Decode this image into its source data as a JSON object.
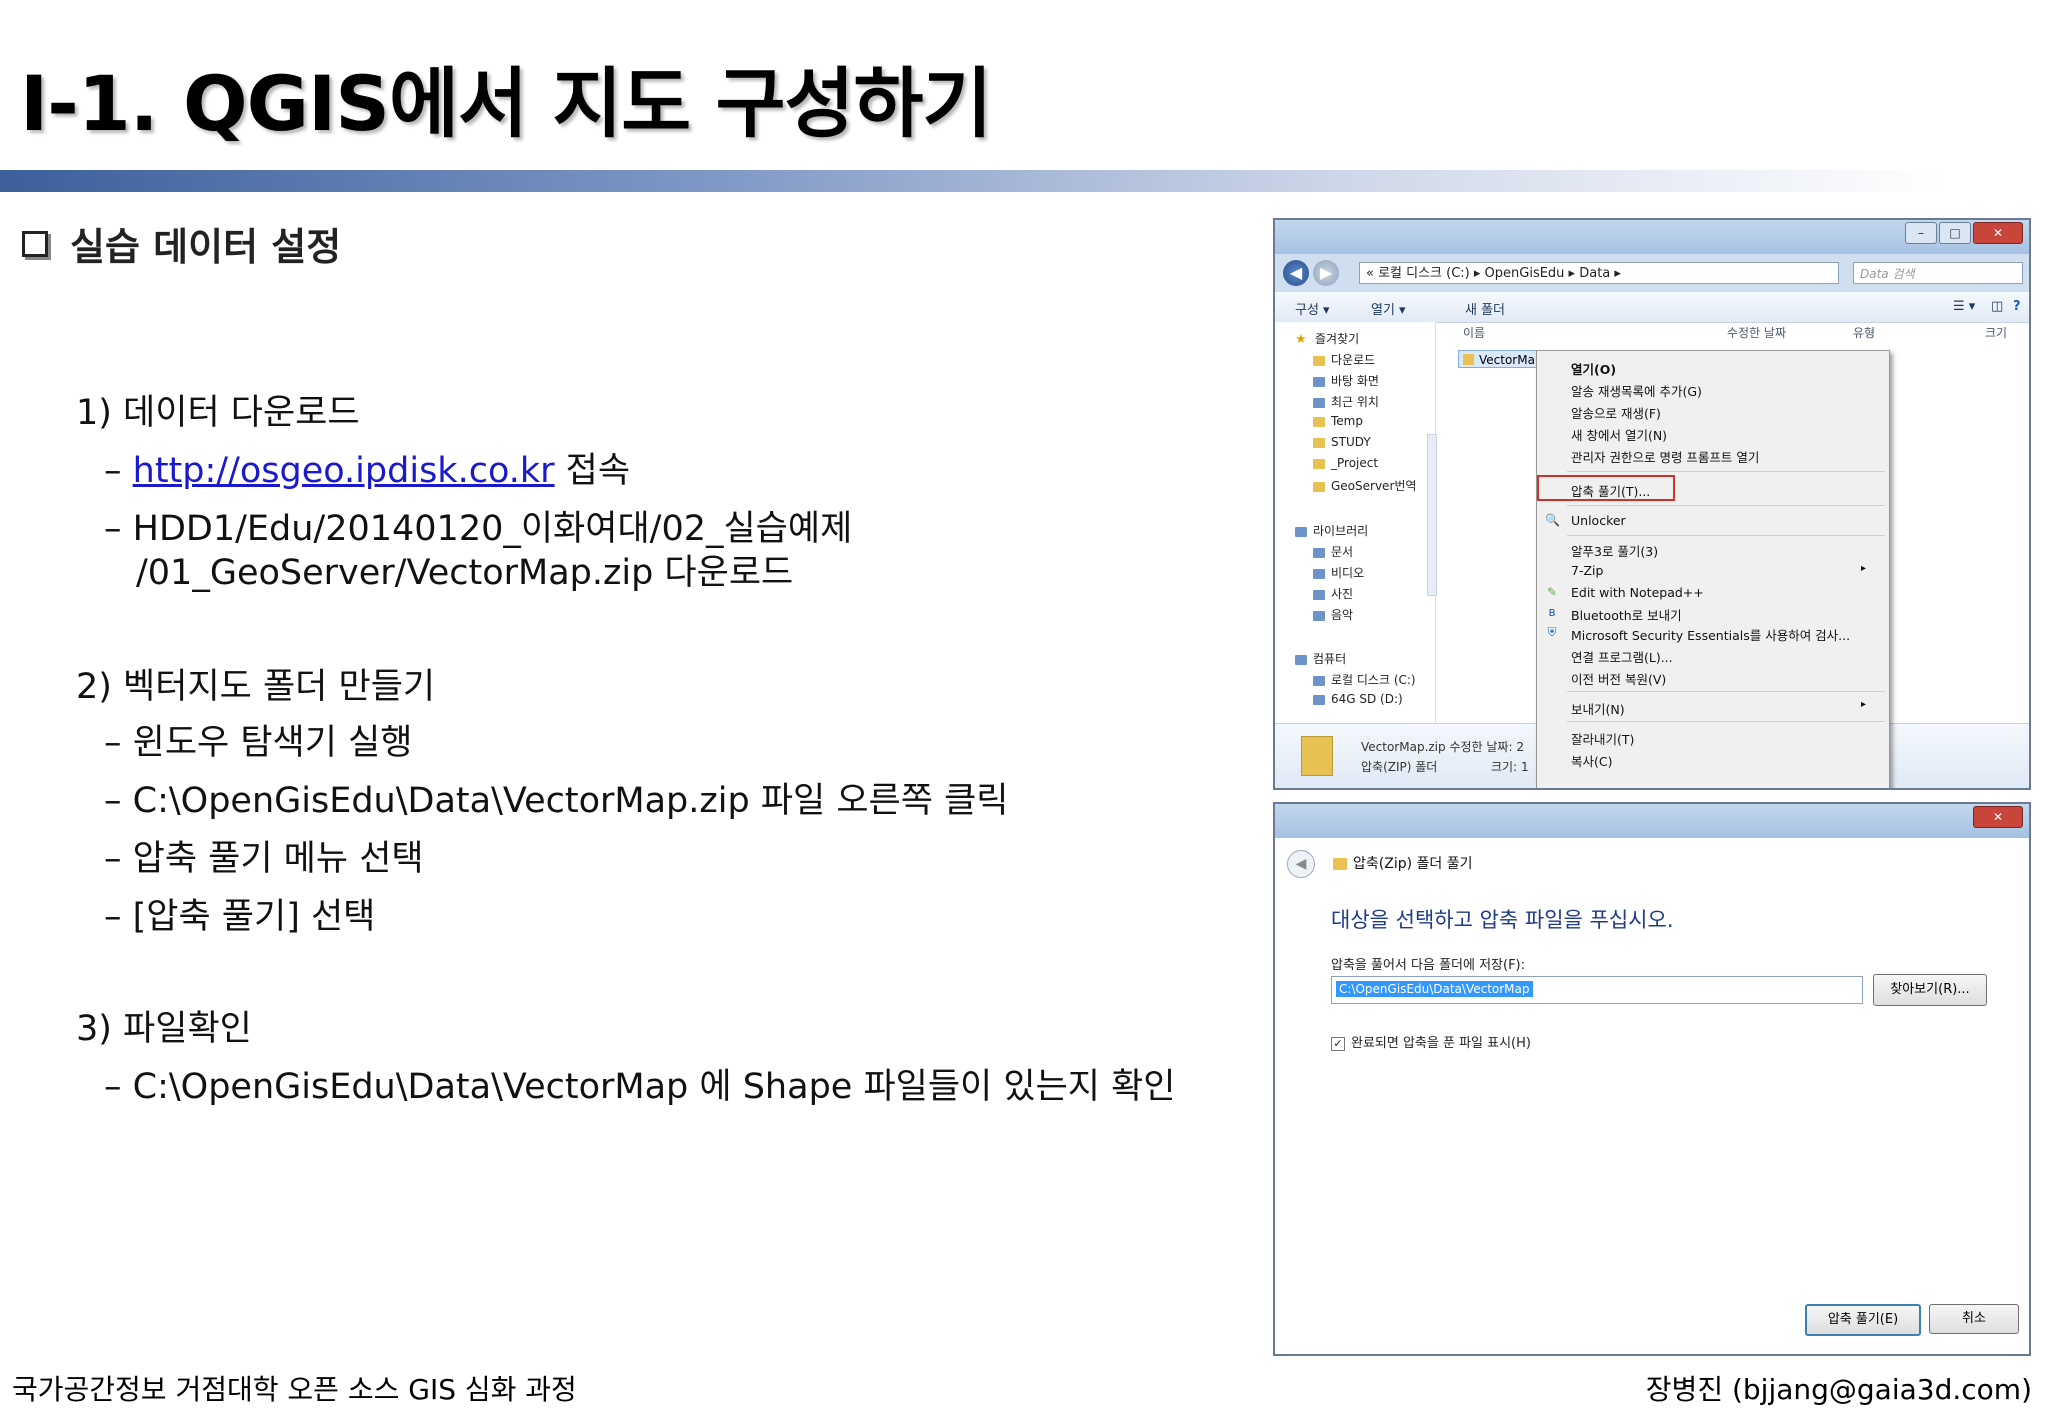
{
  "title": "I-1. QGIS에서 지도 구성하기",
  "section": "실습 데이터 설정",
  "steps": {
    "s1": "1) 데이터 다운로드",
    "s1_link": "http://osgeo.ipdisk.co.kr",
    "s1_link_suffix": " 접속",
    "s1_path1": "– HDD1/Edu/20140120_이화여대/02_실습예제",
    "s1_path2": "/01_GeoServer/VectorMap.zip 다운로드",
    "s2": "2) 벡터지도 폴더 만들기",
    "s2_a": "– 윈도우 탐색기 실행",
    "s2_b": "– C:\\OpenGisEdu\\Data\\VectorMap.zip 파일 오른쪽 클릭",
    "s2_c": "– 압축 풀기 메뉴 선택",
    "s2_d": "– [압축 풀기] 선택",
    "s3": "3) 파일확인",
    "s3_a": "– C:\\OpenGisEdu\\Data\\VectorMap 에 Shape 파일들이 있는지 확인"
  },
  "footer": {
    "left": "국가공간정보 거점대학 오픈 소스 GIS 심화 과정",
    "right": "장병진 (bjjang@gaia3d.com)"
  },
  "explorer": {
    "address": "« 로컬 디스크 (C:) ▸ OpenGisEdu ▸ Data ▸",
    "search_placeholder": "Data 검색",
    "toolbar": {
      "organize": "구성 ▾",
      "open": "열기 ▾",
      "new_folder": "새 폴더"
    },
    "nav": {
      "favorites": "즐겨찾기",
      "downloads": "다운로드",
      "desktop": "바탕 화면",
      "recent": "최근 위치",
      "temp": "Temp",
      "study": "STUDY",
      "project": "_Project",
      "geoserver": "GeoServer번역",
      "library": "라이브러리",
      "documents": "문서",
      "videos": "비디오",
      "pictures": "사진",
      "music": "음악",
      "computer": "컴퓨터",
      "local_disk": "로컬 디스크 (C:)",
      "sd": "64G SD (D:)"
    },
    "columns": {
      "name": "이름",
      "modified": "수정한 날짜",
      "type": "유형",
      "size": "크기"
    },
    "file_name": "VectorMap",
    "details": {
      "name": "VectorMap.zip  수정한 날짜: 2",
      "type": "압축(ZIP) 폴더",
      "size": "크기: 1"
    },
    "context_menu": {
      "open": "열기(O)",
      "add_favorite": "알송 재생목록에 추가(G)",
      "play_alsong": "알송으로 재생(F)",
      "new_window": "새 창에서 열기(N)",
      "admin_prompt": "관리자 권한으로 명령 프롬프트 열기",
      "extract_all": "압축 풀기(T)...",
      "unlocker": "Unlocker",
      "extract_here": "알푸3로 풀기(3)",
      "seven_zip": "7-Zip",
      "notepad": "Edit with Notepad++",
      "bluetooth": "Bluetooth로 보내기",
      "security": "Microsoft Security Essentials를 사용하여 검사...",
      "open_with": "연결 프로그램(L)...",
      "restore": "이전 버전 복원(V)",
      "send_to": "보내기(N)",
      "cut": "잘라내기(T)",
      "copy": "복사(C)"
    }
  },
  "dialog": {
    "title": "압축(Zip) 폴더 풀기",
    "heading": "대상을 선택하고 압축 파일을 푸십시오.",
    "label": "압축을 풀어서 다음 폴더에 저장(F):",
    "path": "C:\\OpenGisEdu\\Data\\VectorMap",
    "browse": "찾아보기(R)...",
    "checkbox": "완료되면 압축을 푼 파일 표시(H)",
    "checkbox_checked": true,
    "extract": "압축 풀기(E)",
    "cancel": "취소"
  }
}
